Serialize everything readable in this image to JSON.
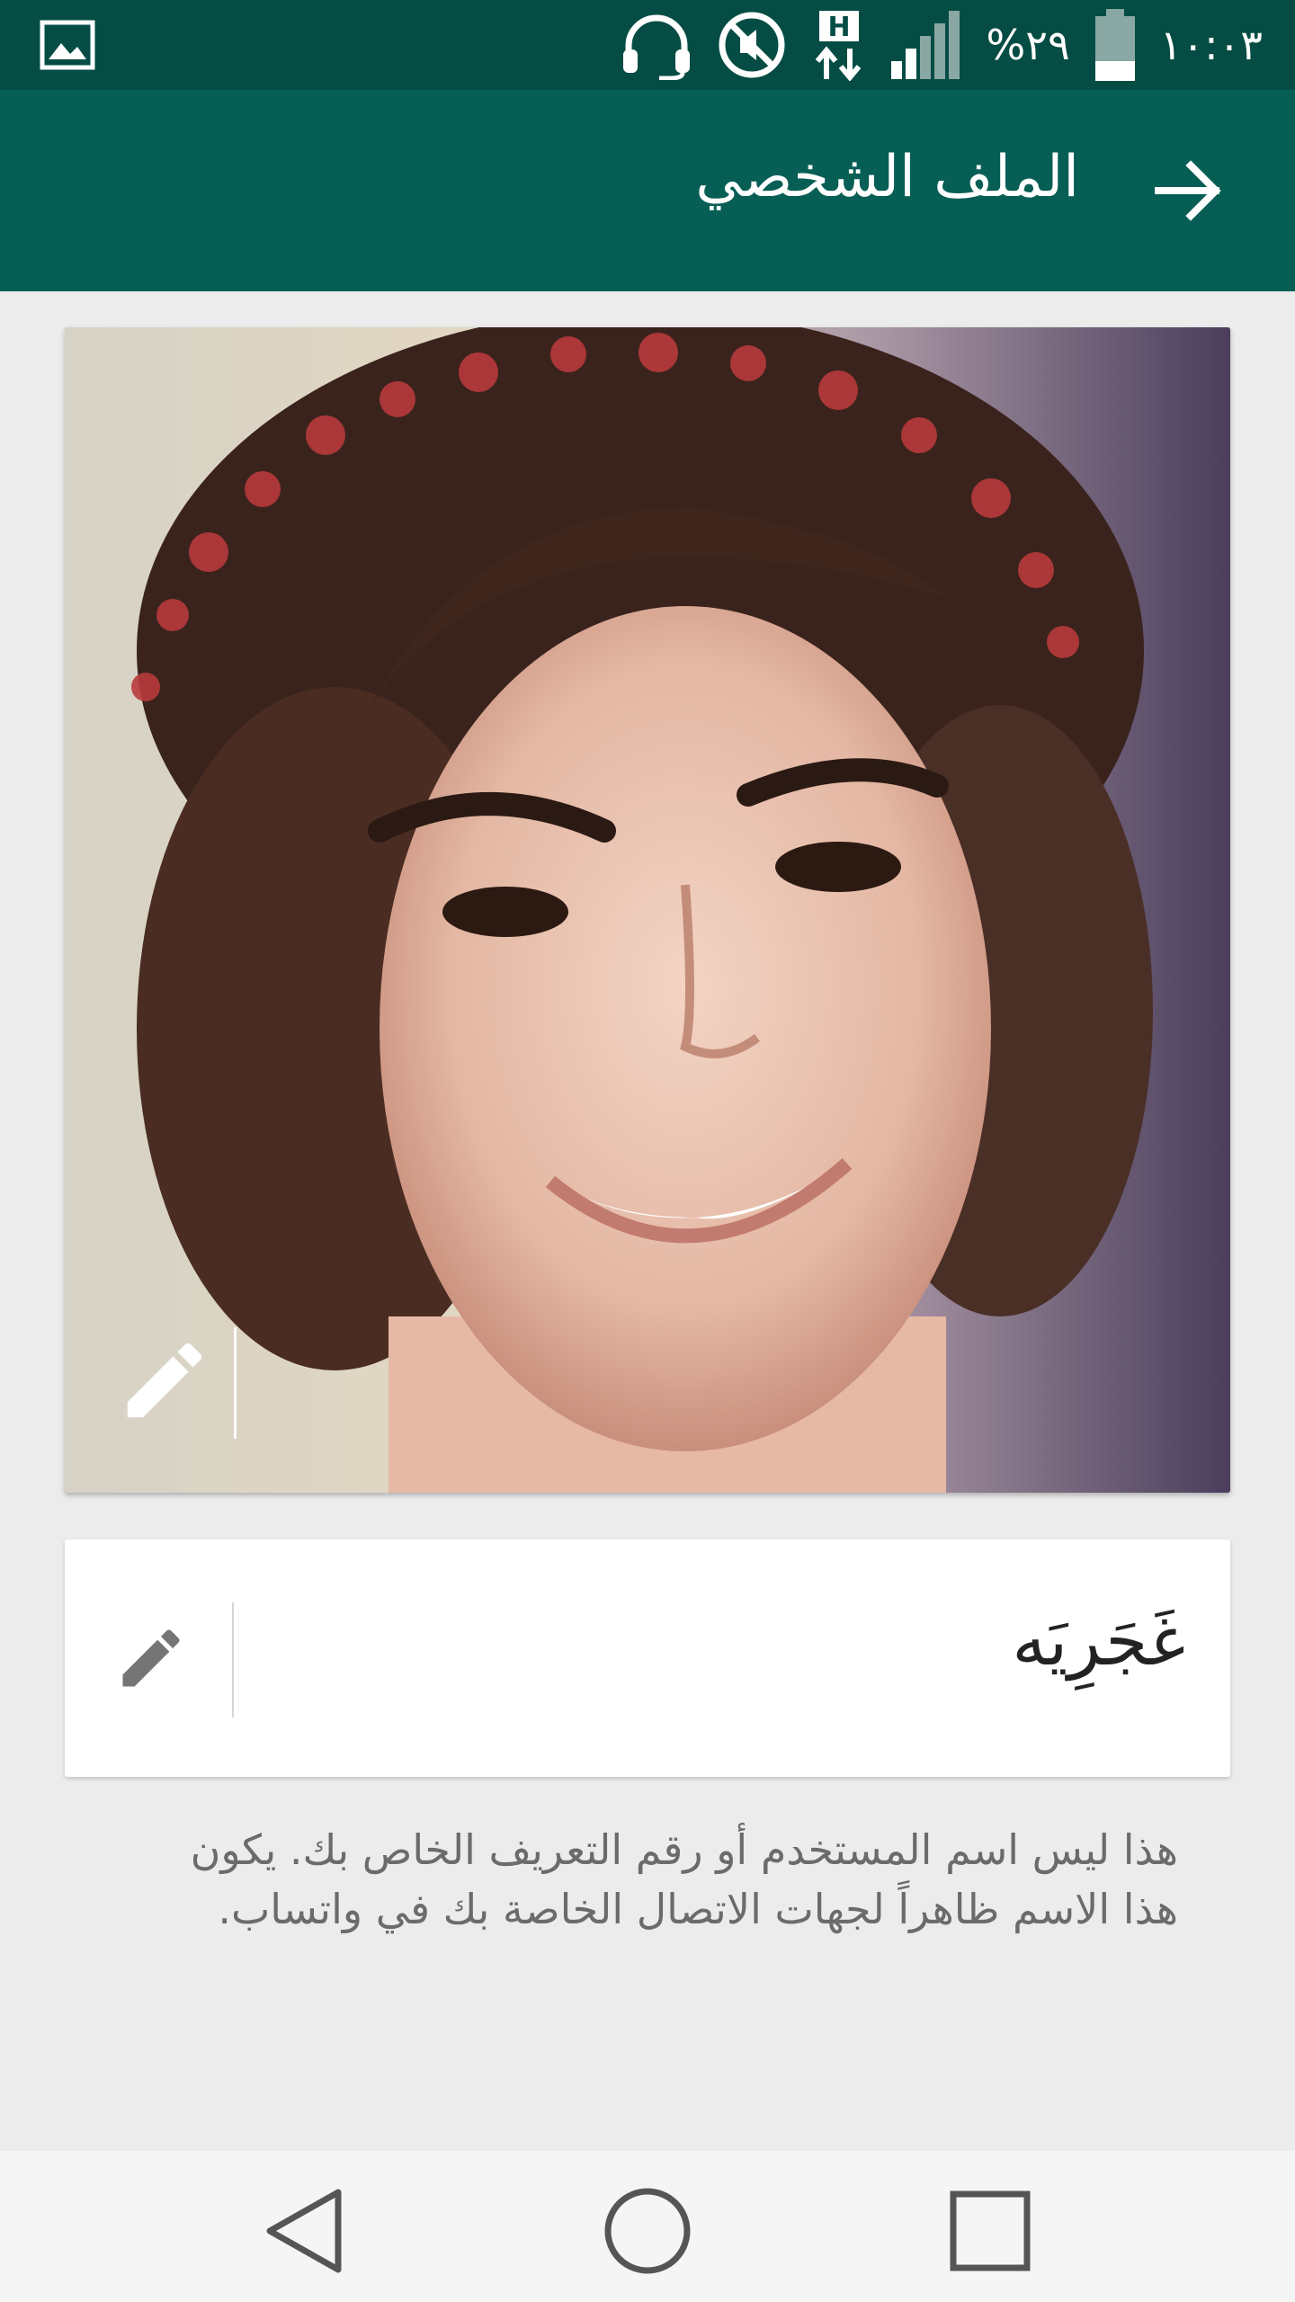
{
  "status_bar": {
    "time": "١٠:٠٣",
    "battery_percent": "%٢٩",
    "network_type": "H",
    "icons": [
      "gallery-icon",
      "headset-icon",
      "muted-icon",
      "data-transfer-icon",
      "signal-icon",
      "battery-icon"
    ]
  },
  "app_bar": {
    "title": "الملف الشخصي",
    "back_icon": "arrow-back-icon"
  },
  "profile": {
    "photo_edit_icon": "pencil-icon",
    "name": "غَجَرِيَه",
    "name_edit_icon": "pencil-icon",
    "hint": "هذا ليس اسم المستخدم أو رقم التعريف الخاص بك. يكون هذا الاسم ظاهراً لجهات الاتصال الخاصة بك في واتساب."
  },
  "nav_bar": {
    "buttons": [
      "back-triangle-icon",
      "home-circle-icon",
      "recents-square-icon"
    ]
  },
  "colors": {
    "status_bar": "#054d44",
    "app_bar": "#075e54",
    "background": "#ececec"
  }
}
